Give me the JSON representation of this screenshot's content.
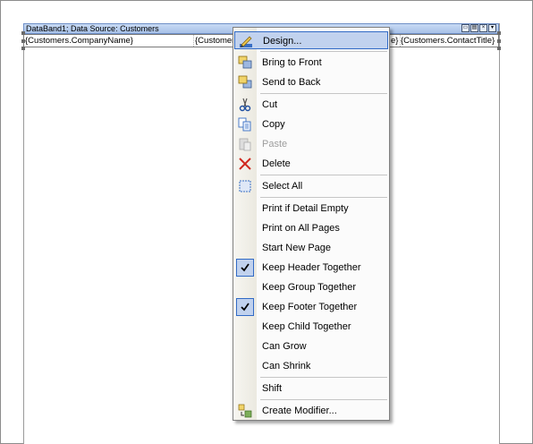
{
  "band": {
    "title": "DataBand1; Data Source: Customers",
    "fields": [
      "{Customers.CompanyName}",
      "{Customers",
      "e}",
      "{Customers.ContactTitle}"
    ]
  },
  "menu": {
    "design": "Design...",
    "bring_to_front": "Bring to Front",
    "send_to_back": "Send to Back",
    "cut": "Cut",
    "copy": "Copy",
    "paste": "Paste",
    "delete": "Delete",
    "select_all": "Select All",
    "print_if_detail_empty": "Print if Detail Empty",
    "print_on_all_pages": "Print on All Pages",
    "start_new_page": "Start New Page",
    "keep_header_together": "Keep Header Together",
    "keep_group_together": "Keep Group Together",
    "keep_footer_together": "Keep Footer Together",
    "keep_child_together": "Keep Child Together",
    "can_grow": "Can Grow",
    "can_shrink": "Can Shrink",
    "shift": "Shift",
    "create_modifier": "Create Modifier..."
  },
  "checked": {
    "keep_header_together": true,
    "keep_footer_together": true
  },
  "colors": {
    "selection": "#c1d2ee",
    "selection_border": "#316ac5",
    "band_header": "#a7c1e8"
  }
}
